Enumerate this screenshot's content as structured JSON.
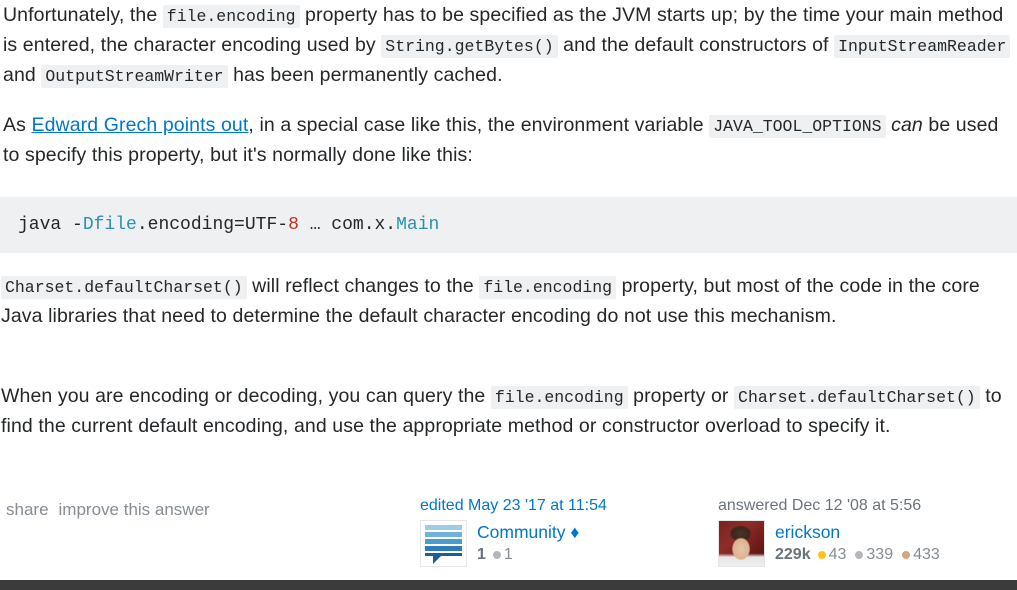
{
  "post": {
    "paragraphs": {
      "p1": {
        "t1": "Unfortunately, the ",
        "c1": "file.encoding",
        "t2": " property has to be specified as the JVM starts up; by the time your main method is entered, the character encoding used by ",
        "c2": "String.getBytes()",
        "t3": " and the default constructors of ",
        "c3": "InputStreamReader",
        "t4": " and ",
        "c4": "OutputStreamWriter",
        "t5": " has been permanently cached."
      },
      "p2": {
        "t1": "As ",
        "link": "Edward Grech points out",
        "t2": ", in a special case like this, the environment variable ",
        "c1": "JAVA_TOOL_OPTIONS",
        "t3": " ",
        "em": "can",
        "t4": " be used to specify this property, but it's normally done like this:"
      },
      "p3": {
        "c1": "Charset.defaultCharset()",
        "t1": " will reflect changes to the ",
        "c2": "file.encoding",
        "t2": " property, but most of the code in the core Java libraries that need to determine the default character encoding do not use this mechanism."
      },
      "p4": {
        "t1": "When you are encoding or decoding, you can query the ",
        "c1": "file.encoding",
        "t2": " property or ",
        "c2": "Charset.defaultCharset()",
        "t3": " to find the current default encoding, and use the appropriate method or constructor overload to specify it."
      }
    },
    "code_block": {
      "language": "shell",
      "tokens": {
        "cmd": "java ",
        "dash": "-",
        "flag": "Dfile",
        "prop": ".encoding=UTF-",
        "num": "8",
        "args": " … com.x.",
        "cls": "Main"
      },
      "full_text": "java -Dfile.encoding=UTF-8 … com.x.Main"
    }
  },
  "footer": {
    "menu": {
      "share": "share",
      "improve": "improve this answer"
    },
    "editor_card": {
      "action_time": "edited May 23 '17 at 11:54",
      "avatar_icon": "community-speech-bubble-icon",
      "username": "Community",
      "moderator_diamond": "♦",
      "badges": {
        "silver_count": "1",
        "bronze_count": "1"
      }
    },
    "answerer_card": {
      "action_time": "answered Dec 12 '08 at 5:56",
      "avatar_icon": "user-photo-avatar",
      "username": "erickson",
      "reputation": "229k",
      "badges": {
        "gold_count": "43",
        "silver_count": "339",
        "bronze_count": "433"
      }
    }
  },
  "colors": {
    "link": "#0077cc",
    "muted_text": "#6a737c",
    "menu_text": "#848d95",
    "code_background": "#eff0f1",
    "gold_badge": "#fcc419",
    "silver_badge": "#b4b8bc",
    "bronze_badge": "#d1a684",
    "bottom_bar": "#3b3b3b"
  }
}
